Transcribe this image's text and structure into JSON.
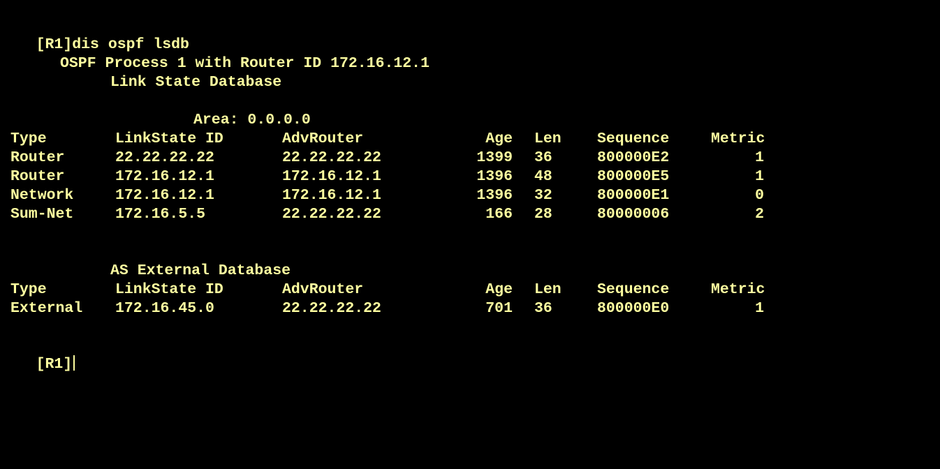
{
  "terminal": {
    "command_prompt": "[R1]",
    "command": "dis ospf lsdb",
    "process_line": "OSPF Process 1 with Router ID 172.16.12.1",
    "lsdb_title": "Link State Database",
    "area_line": "Area: 0.0.0.0",
    "headers": {
      "type": "Type",
      "linkstate_id": "LinkState ID",
      "advrouter": "AdvRouter",
      "age": "Age",
      "len": "Len",
      "sequence": "Sequence",
      "metric": "Metric"
    },
    "area_rows": [
      {
        "type": "Router",
        "linkstate_id": "22.22.22.22",
        "advrouter": "22.22.22.22",
        "age": "1399",
        "len": "36",
        "sequence": "800000E2",
        "metric": "1"
      },
      {
        "type": "Router",
        "linkstate_id": "172.16.12.1",
        "advrouter": "172.16.12.1",
        "age": "1396",
        "len": "48",
        "sequence": "800000E5",
        "metric": "1"
      },
      {
        "type": "Network",
        "linkstate_id": "172.16.12.1",
        "advrouter": "172.16.12.1",
        "age": "1396",
        "len": "32",
        "sequence": "800000E1",
        "metric": "0"
      },
      {
        "type": "Sum-Net",
        "linkstate_id": "172.16.5.5",
        "advrouter": "22.22.22.22",
        "age": "166",
        "len": "28",
        "sequence": "80000006",
        "metric": "2"
      }
    ],
    "ase_title": "AS External Database",
    "ase_rows": [
      {
        "type": "External",
        "linkstate_id": "172.16.45.0",
        "advrouter": "22.22.22.22",
        "age": "701",
        "len": "36",
        "sequence": "800000E0",
        "metric": "1"
      }
    ],
    "final_prompt": "[R1]"
  }
}
